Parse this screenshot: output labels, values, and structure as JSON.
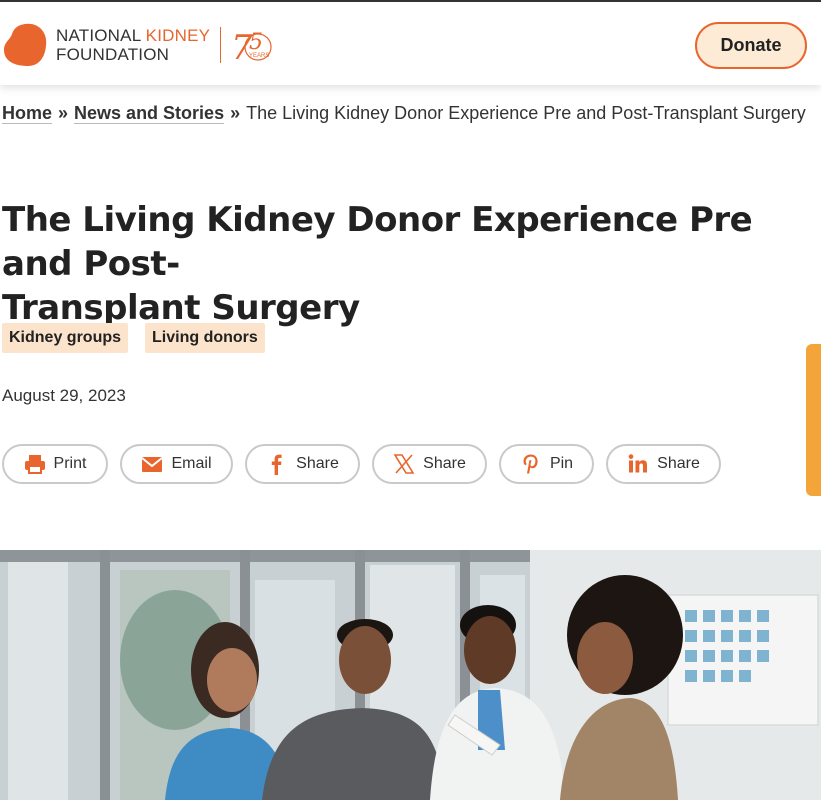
{
  "header": {
    "logo_line1_a": "NATIONAL ",
    "logo_line1_b": "KIDNEY",
    "logo_line2": "FOUNDATION",
    "logo_years": "YEARS",
    "donate_label": "Donate",
    "brand_color": "#e8662d"
  },
  "breadcrumb": {
    "home": "Home",
    "sep": "»",
    "section": "News and Stories",
    "current": "The Living Kidney Donor Experience Pre and Post-Transplant Surgery"
  },
  "article": {
    "title_line1": "The Living Kidney Donor Experience Pre and Post-",
    "title_line2": "Transplant Surgery",
    "tags": [
      "Kidney groups",
      "Living donors"
    ],
    "date": "August 29, 2023"
  },
  "share": {
    "buttons": [
      {
        "label": "Print",
        "icon": "print-icon"
      },
      {
        "label": "Email",
        "icon": "email-icon"
      },
      {
        "label": "Share",
        "icon": "facebook-icon"
      },
      {
        "label": "Share",
        "icon": "x-icon"
      },
      {
        "label": "Pin",
        "icon": "pinterest-icon"
      },
      {
        "label": "Share",
        "icon": "linkedin-icon"
      }
    ]
  }
}
